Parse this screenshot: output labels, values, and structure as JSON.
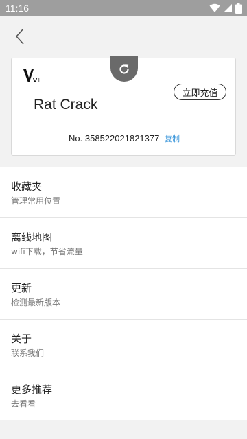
{
  "status_bar": {
    "time": "11:16"
  },
  "header": {
    "back_icon": "chevron-left-icon"
  },
  "card": {
    "vip_logo": "VIP",
    "recharge_label": "立即充值",
    "username": "Rat Crack",
    "member_prefix": "No.",
    "member_number": "358522021821377",
    "copy_label": "复制",
    "refresh_icon": "refresh-icon",
    "accent_color": "#2d8fd8"
  },
  "menu": {
    "items": [
      {
        "title": "收藏夹",
        "subtitle": "管理常用位置"
      },
      {
        "title": "离线地图",
        "subtitle": "wifi下载，节省流量"
      },
      {
        "title": "更新",
        "subtitle": "检测最新版本"
      },
      {
        "title": "关于",
        "subtitle": "联系我们"
      },
      {
        "title": "更多推荐",
        "subtitle": "去看看"
      }
    ]
  }
}
